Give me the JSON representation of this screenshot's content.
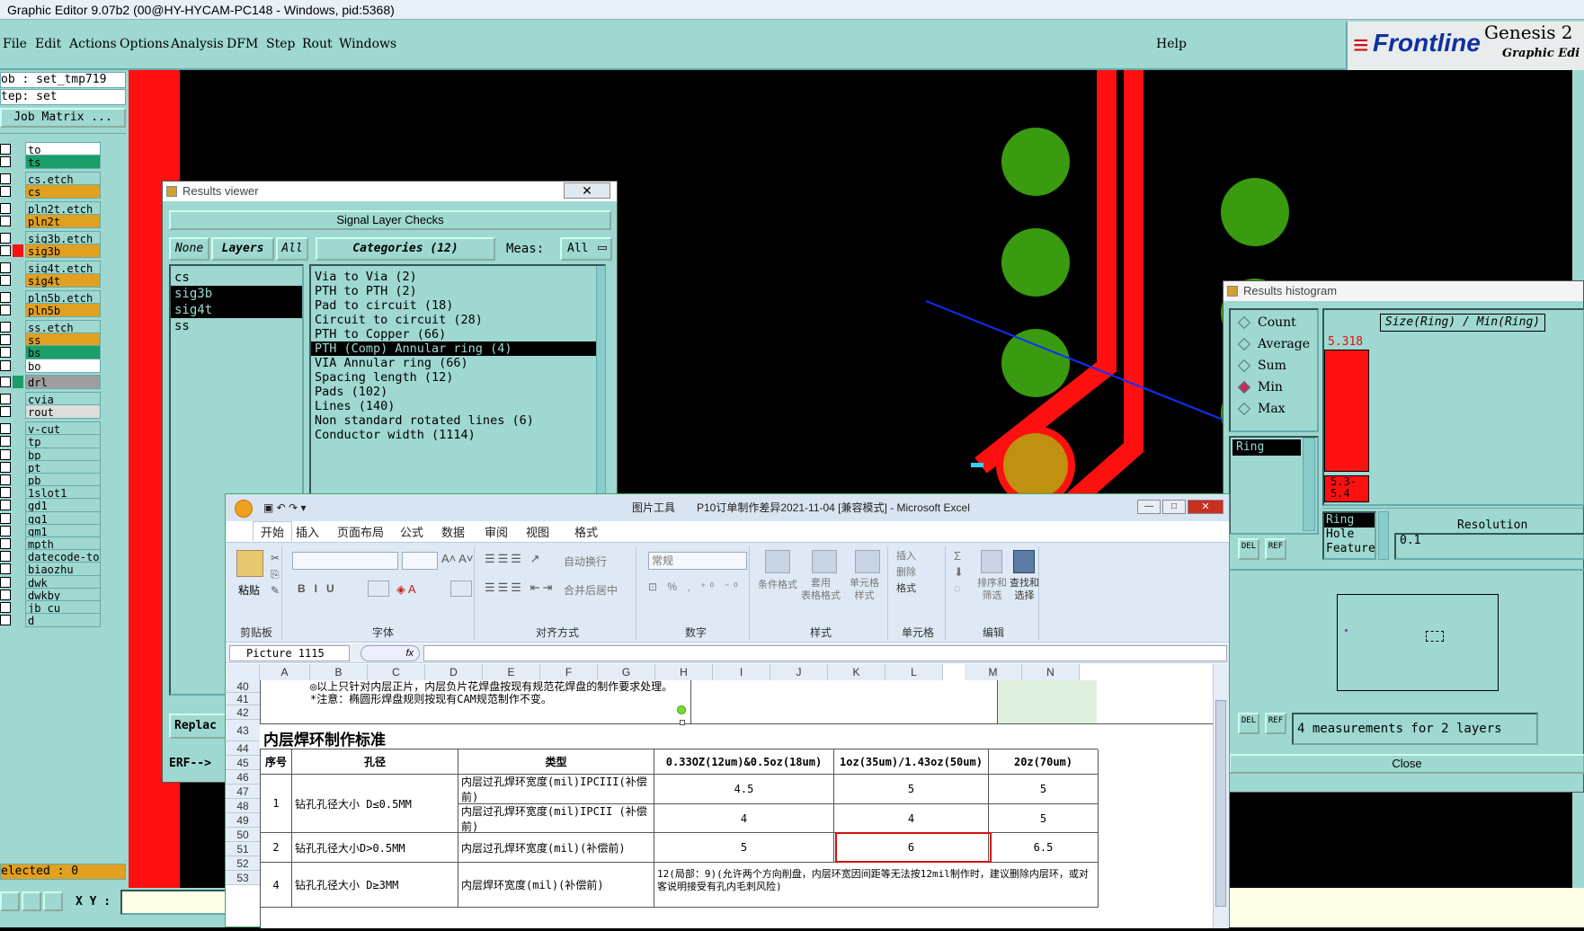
{
  "window_title": "Graphic Editor 9.07b2 (00@HY-HYCAM-PC148 - Windows, pid:5368)",
  "menu": [
    "File",
    "Edit",
    "Actions",
    "Options",
    "Analysis",
    "DFM",
    "Step",
    "Rout",
    "Windows"
  ],
  "help": "Help",
  "logo": {
    "brand": "Frontline",
    "product": "Genesis 2",
    "subtitle": "Graphic Edi"
  },
  "job": {
    "job_label": "ob : set_tmp719",
    "step_label": "tep: set",
    "matrix_button": "Job Matrix ..."
  },
  "layers": [
    {
      "name": "to",
      "color": "#ffffff"
    },
    {
      "name": "ts",
      "color": "#1a9e6a"
    },
    {
      "name": "cs.etch",
      "color": "#9ed8d0"
    },
    {
      "name": "cs",
      "color": "#e0a020"
    },
    {
      "name": "pln2t.etch",
      "color": "#9ed8d0"
    },
    {
      "name": "pln2t",
      "color": "#e0a020"
    },
    {
      "name": "sig3b.etch",
      "color": "#9ed8d0"
    },
    {
      "name": "sig3b",
      "color": "#e0a020"
    },
    {
      "name": "sig4t.etch",
      "color": "#9ed8d0"
    },
    {
      "name": "sig4t",
      "color": "#e0a020"
    },
    {
      "name": "pln5b.etch",
      "color": "#9ed8d0"
    },
    {
      "name": "pln5b",
      "color": "#e0a020"
    },
    {
      "name": "ss.etch",
      "color": "#9ed8d0"
    },
    {
      "name": "ss",
      "color": "#e0a020"
    },
    {
      "name": "bs",
      "color": "#1a9e6a"
    },
    {
      "name": "bo",
      "color": "#ffffff"
    },
    {
      "name": "drl",
      "color": "#9e9e9e"
    },
    {
      "name": "cvia",
      "color": "#9ed8d0"
    },
    {
      "name": "rout",
      "color": "#dddddd"
    },
    {
      "name": "v-cut",
      "color": "#9ed8d0"
    },
    {
      "name": "tp",
      "color": "#9ed8d0"
    },
    {
      "name": "bp",
      "color": "#9ed8d0"
    },
    {
      "name": "pt",
      "color": "#9ed8d0"
    },
    {
      "name": "pb",
      "color": "#9ed8d0"
    },
    {
      "name": "1slot1",
      "color": "#9ed8d0"
    },
    {
      "name": "gd1",
      "color": "#9ed8d0"
    },
    {
      "name": "gg1",
      "color": "#9ed8d0"
    },
    {
      "name": "gm1",
      "color": "#9ed8d0"
    },
    {
      "name": "mpth",
      "color": "#9ed8d0"
    },
    {
      "name": "datecode-to",
      "color": "#9ed8d0"
    },
    {
      "name": "biaozhu",
      "color": "#9ed8d0"
    },
    {
      "name": "dwk",
      "color": "#9ed8d0"
    },
    {
      "name": "dwkby",
      "color": "#9ed8d0"
    },
    {
      "name": "jb_cu",
      "color": "#9ed8d0"
    },
    {
      "name": "d",
      "color": "#9ed8d0"
    }
  ],
  "selected_count": "elected : 0",
  "xy_label": "X Y :",
  "results_viewer": {
    "title": "Results viewer",
    "header": "Signal Layer Checks",
    "none_btn": "None",
    "layers_btn": "Layers",
    "all_btn": "All",
    "categories_btn": "Categories (12)",
    "meas_label": "Meas:",
    "meas_value": "All",
    "layer_list": [
      {
        "name": "cs",
        "selected": false
      },
      {
        "name": "sig3b",
        "selected": true
      },
      {
        "name": "sig4t",
        "selected": true
      },
      {
        "name": "ss",
        "selected": false
      }
    ],
    "categories": [
      {
        "name": "Via to Via (2)",
        "selected": false
      },
      {
        "name": "PTH to PTH (2)",
        "selected": false
      },
      {
        "name": "Pad to circuit (18)",
        "selected": false
      },
      {
        "name": "Circuit to circuit (28)",
        "selected": false
      },
      {
        "name": "PTH to Copper (66)",
        "selected": false
      },
      {
        "name": "PTH (Comp) Annular ring (4)",
        "selected": true
      },
      {
        "name": "VIA Annular ring (66)",
        "selected": false
      },
      {
        "name": "Spacing length (12)",
        "selected": false
      },
      {
        "name": "Pads (102)",
        "selected": false
      },
      {
        "name": "Lines (140)",
        "selected": false
      },
      {
        "name": "Non standard rotated lines (6)",
        "selected": false
      },
      {
        "name": "Conductor width (1114)",
        "selected": false
      }
    ],
    "replace_btn": "Replac",
    "erf_label": "ERF-->"
  },
  "histogram": {
    "title": "Results histogram",
    "options": [
      {
        "label": "Count",
        "on": false
      },
      {
        "label": "Average",
        "on": false
      },
      {
        "label": "Sum",
        "on": false
      },
      {
        "label": "Min",
        "on": true
      },
      {
        "label": "Max",
        "on": false
      }
    ],
    "axis_title": "Size(Ring) / Min(Ring)",
    "bar_value": "5.318",
    "range_label_1": "5.3-",
    "range_label_2": "5.4",
    "attr_selected": "Ring",
    "attr_list": [
      "Ring",
      "Hole",
      "Feature"
    ],
    "resolution_label": "Resolution",
    "resolution_value": "0.1",
    "del_btn": "DEL",
    "ref_btn": "REF",
    "measurements": "4 measurements for 2 layers",
    "close_btn": "Close"
  },
  "excel": {
    "tools_label": "图片工具",
    "title": "P10订单制作差异2021-11-04  [兼容模式] - Microsoft Excel",
    "tabs": [
      "开始",
      "插入",
      "页面布局",
      "公式",
      "数据",
      "审阅",
      "视图",
      "格式"
    ],
    "groups": [
      "剪贴板",
      "字体",
      "对齐方式",
      "数字",
      "样式",
      "单元格",
      "编辑"
    ],
    "paste": "粘贴",
    "wrap": "自动换行",
    "merge": "合并后居中",
    "number_format": "常规",
    "cond_format": "条件格式",
    "table_format": "套用\n表格格式",
    "cell_style": "单元格\n样式",
    "insert": "插入",
    "delete": "删除",
    "format": "格式",
    "sort_filter": "排序和\n筛选",
    "find_select": "查找和\n选择",
    "name_box": "Picture 1115",
    "fx": "fx",
    "columns": [
      "A",
      "B",
      "C",
      "D",
      "E",
      "F",
      "G",
      "H",
      "I",
      "J",
      "K",
      "L",
      "M",
      "N"
    ],
    "rows": [
      "40",
      "41",
      "42",
      "43",
      "44",
      "45",
      "46",
      "47",
      "48",
      "49",
      "50",
      "51",
      "52",
      "53"
    ],
    "note1": "◎以上只针对内层正片，内层负片花焊盘按现有规范花焊盘的制作要求处理。",
    "note2": "*注意：椭圆形焊盘规则按现有CAM规范制作不变。",
    "section_title": "内层焊环制作标准",
    "table_headers": [
      "序号",
      "孔径",
      "类型",
      "0.33OZ(12um)&0.5oz(18um)",
      "1oz(35um)/1.43oz(50um)",
      "20z(70um)"
    ],
    "table_rows": [
      {
        "no": "1",
        "hole": "钻孔孔径大小  D≤0.5MM",
        "type": "内层过孔焊环宽度(mil)IPCIII(补偿前)",
        "v1": "4.5",
        "v2": "5",
        "v3": "5"
      },
      {
        "no": "",
        "hole": "",
        "type": "内层过孔焊环宽度(mil)IPCII (补偿前)",
        "v1": "4",
        "v2": "4",
        "v3": "5"
      },
      {
        "no": "2",
        "hole": "钻孔孔径大小D>0.5MM",
        "type": "内层过孔焊环宽度(mil)(补偿前)",
        "v1": "5",
        "v2": "6",
        "v3": "6.5"
      },
      {
        "no": "4",
        "hole": "钻孔孔径大小   D≥3MM",
        "type": "内层焊环宽度(mil)(补偿前)",
        "v1": "12(局部：9)(允许两个方向削盘，内层环宽因间距等无法按12mil制作时，建议删除内层环，或对客说明接受有孔内毛刺风险)",
        "v2": "",
        "v3": ""
      }
    ]
  }
}
